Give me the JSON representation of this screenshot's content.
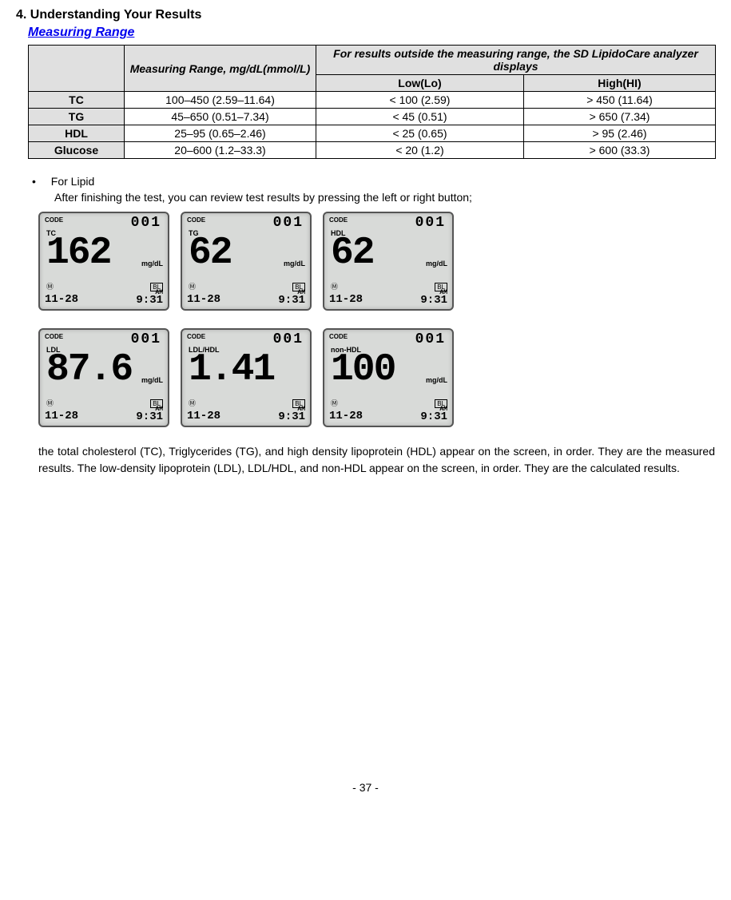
{
  "heading": "4. Understanding Your Results",
  "subheading": "Measuring Range",
  "table": {
    "header_range": "Measuring Range, mg/dL(mmol/L)",
    "header_outside": "For results outside the measuring range, the SD LipidoCare analyzer displays",
    "header_low": "Low(Lo)",
    "header_high": "High(HI)",
    "rows": [
      {
        "label": "TC",
        "range": "100–450 (2.59–11.64)",
        "low": "< 100 (2.59)",
        "high": "> 450 (11.64)"
      },
      {
        "label": "TG",
        "range": "45–650 (0.51–7.34)",
        "low": "< 45 (0.51)",
        "high": "> 650 (7.34)"
      },
      {
        "label": "HDL",
        "range": "25–95 (0.65–2.46)",
        "low": "< 25 (0.65)",
        "high": "> 95 (2.46)"
      },
      {
        "label": "Glucose",
        "range": "20–600 (1.2–33.3)",
        "low": "< 20 (1.2)",
        "high": "> 600 (33.3)"
      }
    ]
  },
  "bullet": {
    "title": "For Lipid",
    "line1": "After finishing the test, you can review test results by pressing the left or right button;"
  },
  "screens": [
    {
      "type": "TC",
      "code": "001",
      "value": "162",
      "unit": "mg/dL",
      "date": "11-28",
      "ampm": "AM",
      "time": "9:31",
      "bl": "BL",
      "mem": "Ⓜ"
    },
    {
      "type": "TG",
      "code": "001",
      "value": "62",
      "unit": "mg/dL",
      "date": "11-28",
      "ampm": "AM",
      "time": "9:31",
      "bl": "BL",
      "mem": "Ⓜ"
    },
    {
      "type": "HDL",
      "code": "001",
      "value": "62",
      "unit": "mg/dL",
      "date": "11-28",
      "ampm": "AM",
      "time": "9:31",
      "bl": "BL",
      "mem": "Ⓜ"
    },
    {
      "type": "LDL",
      "code": "001",
      "value": "87.6",
      "unit": "mg/dL",
      "date": "11-28",
      "ampm": "AM",
      "time": "9:31",
      "bl": "BL",
      "mem": "Ⓜ"
    },
    {
      "type": "LDL/HDL",
      "code": "001",
      "value": "1.41",
      "unit": "",
      "date": "11-28",
      "ampm": "AM",
      "time": "9:31",
      "bl": "BL",
      "mem": "Ⓜ"
    },
    {
      "type": "non-HDL",
      "code": "001",
      "value": "100",
      "unit": "mg/dL",
      "date": "11-28",
      "ampm": "AM",
      "time": "9:31",
      "bl": "BL",
      "mem": "Ⓜ"
    }
  ],
  "desc": "the total cholesterol (TC), Triglycerides (TG), and high density lipoprotein (HDL) appear on the screen, in order. They are the measured results. The low-density lipoprotein (LDL), LDL/HDL, and non-HDL appear on the screen, in order. They are the calculated results.",
  "code_label": "CODE",
  "page_number": "- 37 -"
}
